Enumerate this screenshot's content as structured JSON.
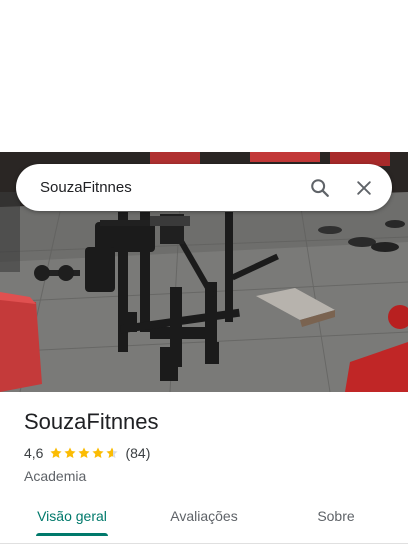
{
  "search": {
    "query": "SouzaFitnnes",
    "search_icon": "search-icon",
    "close_icon": "close-icon"
  },
  "photo": {
    "icon": "gym-photo"
  },
  "place": {
    "name": "SouzaFitnnes",
    "rating": "4,6",
    "rating_value": 4.6,
    "review_count": "(84)",
    "category": "Academia"
  },
  "tabs": [
    {
      "label": "Visão geral",
      "active": true
    },
    {
      "label": "Avaliações",
      "active": false
    },
    {
      "label": "Sobre",
      "active": false
    }
  ],
  "colors": {
    "accent": "#00796b",
    "star": "#fbbc04",
    "star_empty": "#dadce0"
  }
}
